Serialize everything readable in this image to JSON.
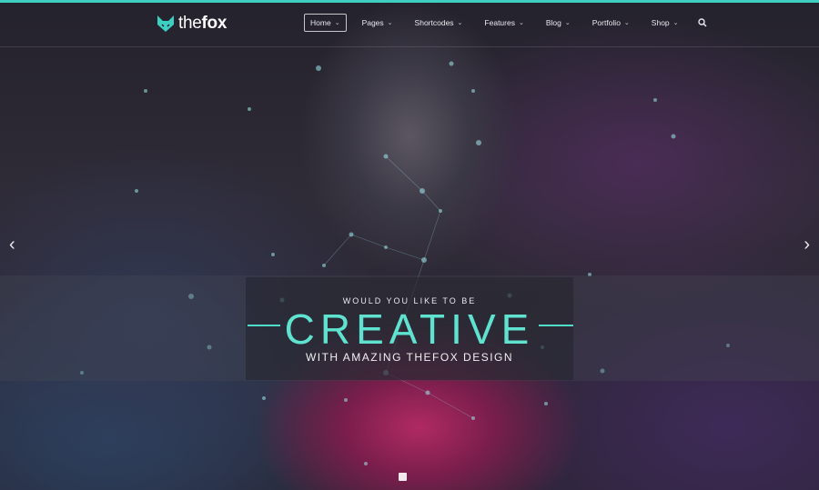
{
  "brand": {
    "logo_bold": "the",
    "logo_rest": "fox",
    "accent": "#3ccfc2"
  },
  "nav": {
    "items": [
      {
        "label": "Home",
        "active": true
      },
      {
        "label": "Pages",
        "active": false
      },
      {
        "label": "Shortcodes",
        "active": false
      },
      {
        "label": "Features",
        "active": false
      },
      {
        "label": "Blog",
        "active": false
      },
      {
        "label": "Portfolio",
        "active": false
      },
      {
        "label": "Shop",
        "active": false
      }
    ],
    "search_icon": "search-icon"
  },
  "hero": {
    "pretitle": "WOULD YOU LIKE TO BE",
    "title": "CREATIVE",
    "subtitle": "WITH AMAZING THEFOX DESIGN",
    "prev_icon": "chevron-left-icon",
    "next_icon": "chevron-right-icon",
    "title_color": "#5fe3d0"
  }
}
